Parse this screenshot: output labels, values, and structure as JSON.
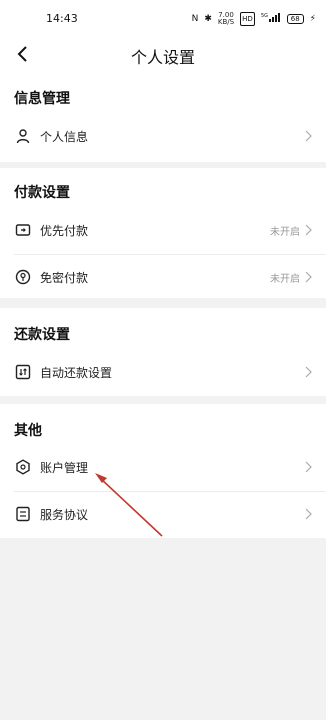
{
  "status_bar": {
    "time": "14:43",
    "nfc": "N",
    "bluetooth": "✱",
    "speed_value": "7.00",
    "speed_unit": "KB/S",
    "hd": "HD",
    "signal": "5G",
    "battery": "68"
  },
  "header": {
    "title": "个人设置"
  },
  "sections": [
    {
      "title": "信息管理",
      "items": [
        {
          "label": "个人信息",
          "value": "",
          "icon": "person-icon"
        }
      ]
    },
    {
      "title": "付款设置",
      "items": [
        {
          "label": "优先付款",
          "value": "未开启",
          "icon": "wallet-icon"
        },
        {
          "label": "免密付款",
          "value": "未开启",
          "icon": "key-icon"
        }
      ]
    },
    {
      "title": "还款设置",
      "items": [
        {
          "label": "自动还款设置",
          "value": "",
          "icon": "repay-icon"
        }
      ]
    },
    {
      "title": "其他",
      "items": [
        {
          "label": "账户管理",
          "value": "",
          "icon": "account-hex-icon"
        },
        {
          "label": "服务协议",
          "value": "",
          "icon": "document-icon"
        }
      ]
    }
  ],
  "colors": {
    "annotation_arrow": "#c0392b",
    "background": "#f2f2f2"
  }
}
